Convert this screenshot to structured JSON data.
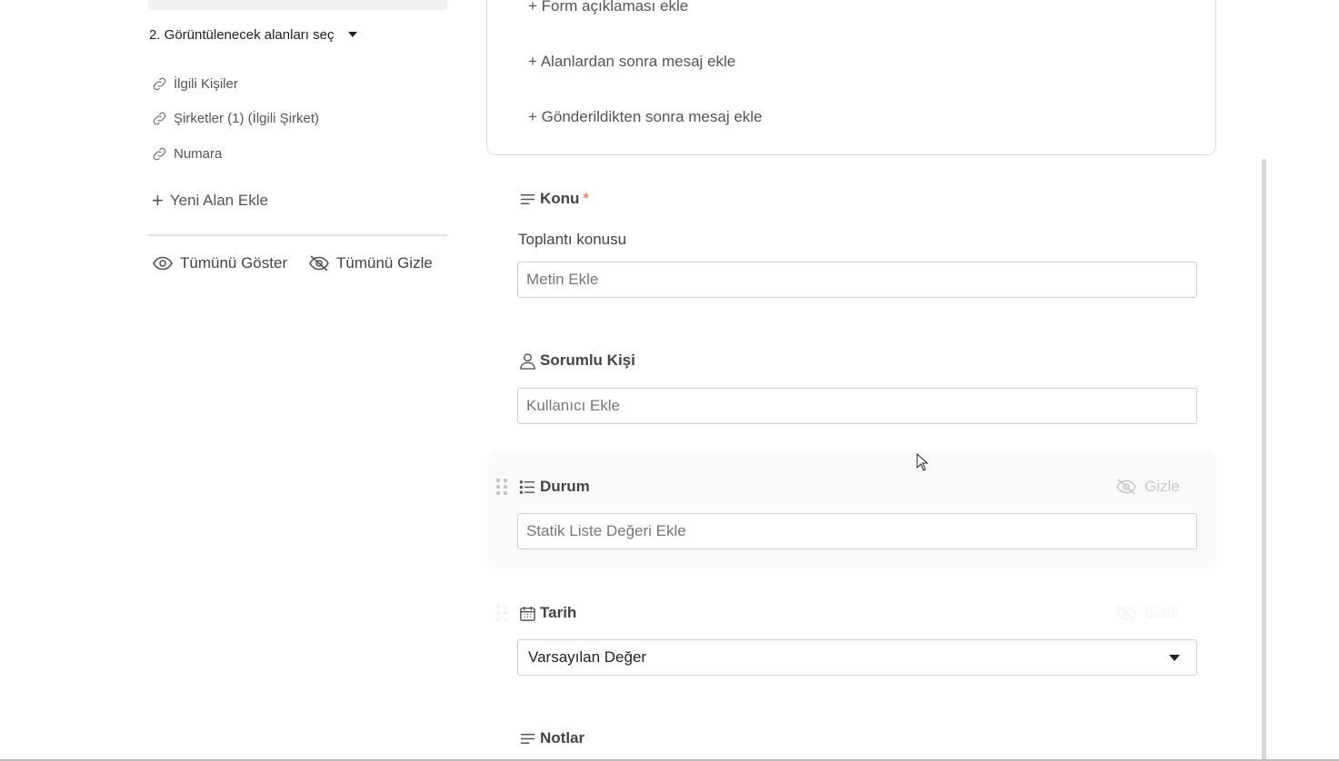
{
  "left_panel": {
    "step_title": "2. Görüntülenecek alanları seç",
    "linked_fields": [
      {
        "label": "İlgili Kişiler"
      },
      {
        "label": "Şirketler (1) (İlgili Şirket)"
      },
      {
        "label": "Numara"
      }
    ],
    "add_field_label": "Yeni Alan Ekle",
    "show_all_label": "Tümünü Göster",
    "hide_all_label": "Tümünü Gizle"
  },
  "form_card": {
    "links": [
      {
        "label": "+ Form açıklaması ekle"
      },
      {
        "label": "+ Alanlardan sonra mesaj ekle"
      },
      {
        "label": "+ Gönderildikten sonra mesaj ekle"
      }
    ]
  },
  "fields": {
    "konu": {
      "title": "Konu",
      "required_mark": "*",
      "description": "Toplantı konusu",
      "placeholder": "Metin Ekle"
    },
    "sorumlu": {
      "title": "Sorumlu Kişi",
      "placeholder": "Kullanıcı Ekle"
    },
    "durum": {
      "title": "Durum",
      "placeholder": "Statik Liste Değeri Ekle",
      "hide_label": "Gizle"
    },
    "tarih": {
      "title": "Tarih",
      "selected": "Varsayılan Değer",
      "hide_label": "Gizle"
    },
    "notlar": {
      "title": "Notlar"
    }
  },
  "colors": {
    "required": "#e36a4a",
    "accent_text": "#444444"
  }
}
